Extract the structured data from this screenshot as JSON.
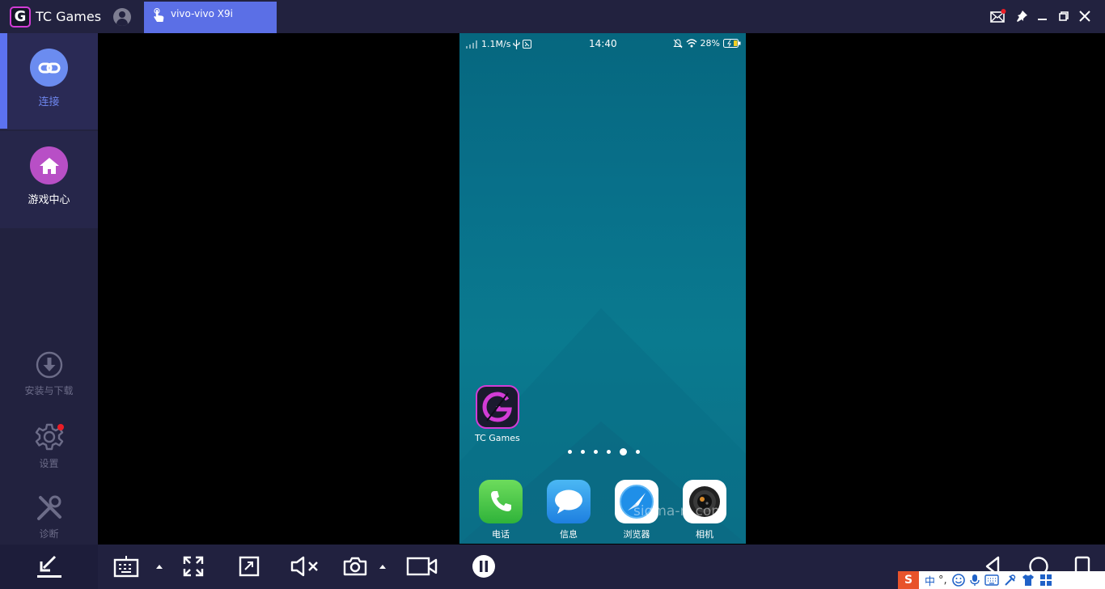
{
  "titlebar": {
    "logo_letter": "G",
    "app_title": "TC Games",
    "device_tab": "vivo-vivo X9i"
  },
  "sidebar": {
    "connect_label": "连接",
    "game_center_label": "游戏中心",
    "install_label": "安装与下载",
    "settings_label": "设置",
    "diagnose_label": "诊断"
  },
  "phone": {
    "network_speed": "1.1M/s",
    "time": "14:40",
    "battery": "28%",
    "tc_games_label": "TC Games",
    "dock": {
      "phone_label": "电话",
      "messages_label": "信息",
      "browser_label": "浏览器",
      "camera_label": "相机"
    },
    "page_count": 6,
    "active_page": 5,
    "watermark": "sigma-rt.com"
  },
  "ime": {
    "logo": "S",
    "lang": "中",
    "punct": "°,"
  },
  "colors": {
    "accent": "#5c72f0",
    "tab_bg": "#5b6fe6",
    "connect_circle": "#6b8cf0",
    "game_circle": "#b84fc6",
    "notification_red": "#ea1d26",
    "titlebar_bg": "#22223f"
  }
}
